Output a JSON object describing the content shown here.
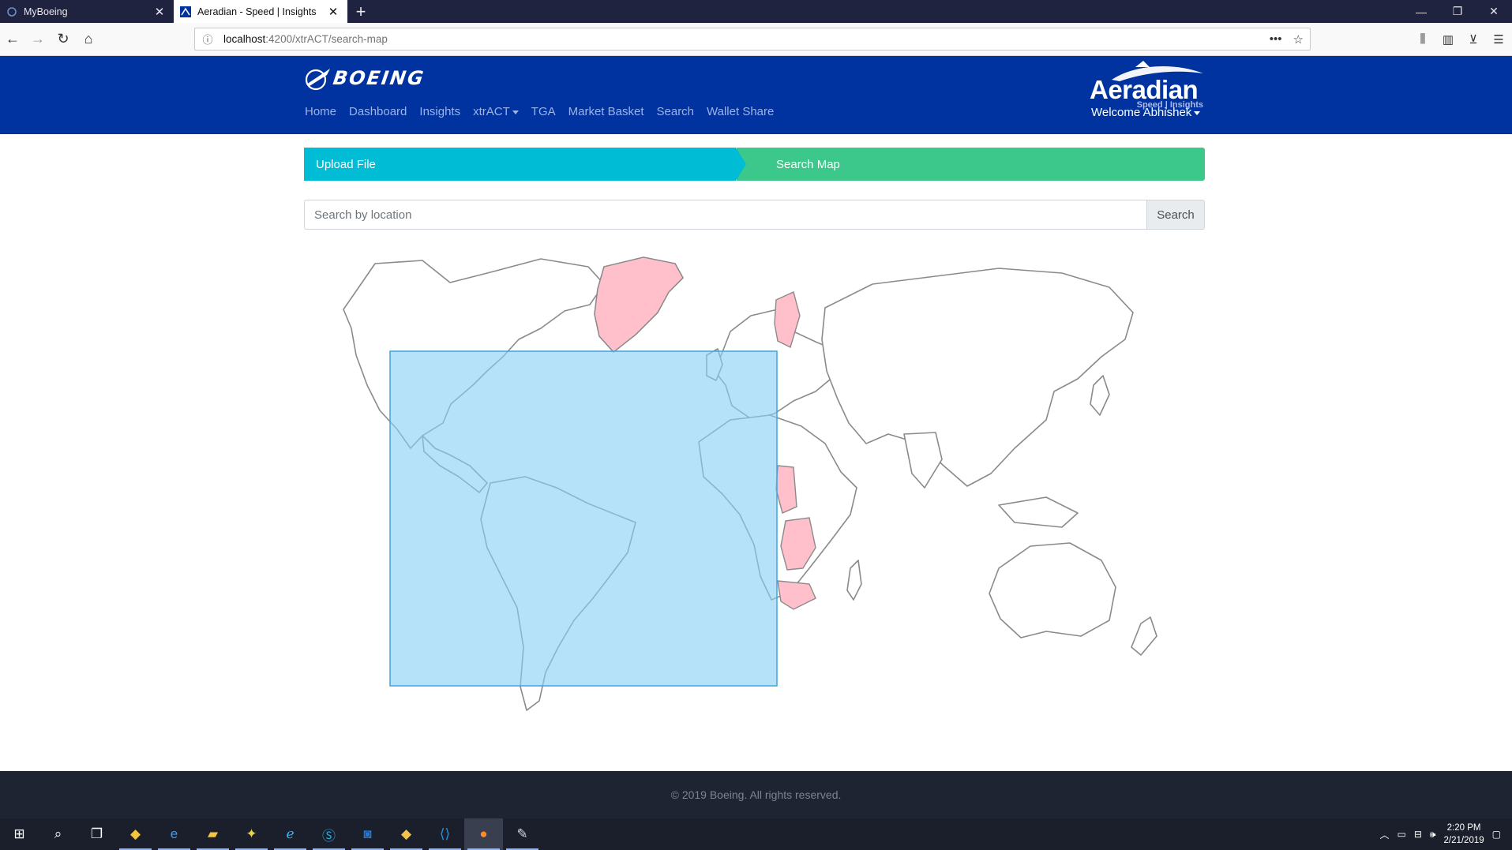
{
  "browser": {
    "tabs": [
      {
        "title": "MyBoeing",
        "active": false
      },
      {
        "title": "Aeradian - Speed | Insights",
        "active": true
      }
    ],
    "url_host": "localhost",
    "url_path": ":4200/xtrACT/search-map"
  },
  "header": {
    "brand": "BOEING",
    "nav": [
      {
        "label": "Home"
      },
      {
        "label": "Dashboard"
      },
      {
        "label": "Insights"
      },
      {
        "label": "xtrACT",
        "dropdown": true
      },
      {
        "label": "TGA"
      },
      {
        "label": "Market Basket"
      },
      {
        "label": "Search"
      },
      {
        "label": "Wallet Share"
      }
    ],
    "product_name": "Aeradian",
    "product_tagline": "Speed | Insights",
    "welcome": "Welcome Abhishek"
  },
  "stepper": {
    "step1": "Upload File",
    "step2": "Search Map"
  },
  "search": {
    "placeholder": "Search by location",
    "button": "Search"
  },
  "footer": {
    "copyright": "© 2019 Boeing. All rights reserved."
  },
  "taskbar": {
    "time": "2:20 PM",
    "date": "2/21/2019"
  },
  "colors": {
    "header_bg": "#0033a0",
    "step1": "#00bcd4",
    "step2": "#3cc88a",
    "highlight_country": "#ffc0cb",
    "selection": "#87cef5"
  }
}
